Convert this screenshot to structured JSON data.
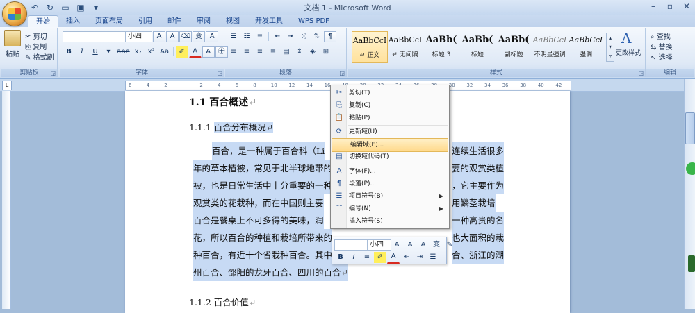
{
  "window": {
    "title": "文档 1 - Microsoft Word"
  },
  "tabs": [
    "开始",
    "插入",
    "页面布局",
    "引用",
    "邮件",
    "审阅",
    "视图",
    "开发工具",
    "WPS PDF"
  ],
  "clipboard": {
    "paste": "粘贴",
    "cut": "剪切",
    "copy": "复制",
    "format_painter": "格式刷",
    "label": "剪贴板"
  },
  "font": {
    "size_value": "小四",
    "label": "字体",
    "bold": "B",
    "italic": "I",
    "underline": "U",
    "strike": "abe",
    "sub": "x₂",
    "sup": "x²",
    "case": "Aa",
    "grow": "A",
    "shrink": "A",
    "phonetic": "变",
    "border_char": "A",
    "font_color": "A",
    "char_shading": "A",
    "enclose": "㊉"
  },
  "paragraph": {
    "label": "段落"
  },
  "styles": {
    "label": "样式",
    "items": [
      {
        "preview": "AaBbCcI",
        "name": "↵ 正文"
      },
      {
        "preview": "AaBbCcI",
        "name": "↵ 无间隔"
      },
      {
        "preview": "AaBb(",
        "name": "标题 3"
      },
      {
        "preview": "AaBb(",
        "name": "标题"
      },
      {
        "preview": "AaBb(",
        "name": "副标题"
      },
      {
        "preview": "AaBbCcI",
        "name": "不明显强调"
      },
      {
        "preview": "AaBbCcI",
        "name": "强调"
      }
    ],
    "change_styles": "更改样式"
  },
  "editing": {
    "label": "编辑",
    "find": "查找",
    "replace": "替换",
    "select": "选择"
  },
  "ruler": {
    "numbers": [
      "6",
      "4",
      "2",
      "",
      "2",
      "4",
      "6",
      "8",
      "10",
      "12",
      "14",
      "16",
      "18",
      "20",
      "22",
      "24",
      "26",
      "28",
      "30",
      "32",
      "34",
      "36",
      "38",
      "40",
      "42"
    ]
  },
  "document": {
    "h1": "1.1 百合概述",
    "h1_mark": "↵",
    "h2": "1.1.1 百合分布概况",
    "h2_mark": "↵",
    "lines": [
      "百合，是一种属于百合科（Li",
      "年的草本植被，常见于北半球地带的",
      "被，也是日常生活中十分重要的一种",
      "观赏类的花栽种，而在中国则主要",
      "百合是餐桌上不可多得的美味，润",
      "花，所以百合的种植和栽培所带来的",
      "种百合，有近十个省栽种百合。其中",
      "州百合、邵阳的龙牙百合、四川的百合"
    ],
    "right_fragments": [
      "连续生活很多",
      "要的观赏类植",
      "，它主要作为",
      "用鳞茎栽培",
      "一种高贵的名",
      "也大面积的栽",
      "合、浙江的湖",
      ""
    ],
    "last_end_mark": "↵",
    "h3": "1.1.2 百合价值",
    "h3_mark": "↵"
  },
  "context_menu": {
    "items": [
      {
        "label": "剪切(T)",
        "icon": "✂"
      },
      {
        "label": "复制(C)",
        "icon": "⎘"
      },
      {
        "label": "粘贴(P)",
        "icon": "📋"
      },
      {
        "label": "更新域(U)",
        "icon": "⟳"
      },
      {
        "label": "编辑域(E)...",
        "icon": ""
      },
      {
        "label": "切换域代码(T)",
        "icon": "▤"
      },
      {
        "label": "字体(F)...",
        "icon": "A"
      },
      {
        "label": "段落(P)...",
        "icon": "¶"
      },
      {
        "label": "项目符号(B)",
        "icon": "☰"
      },
      {
        "label": "编号(N)",
        "icon": "☷"
      },
      {
        "label": "插入符号(S)",
        "icon": ""
      }
    ],
    "highlighted_index": 4
  },
  "mini_toolbar": {
    "size_value": "小四"
  },
  "colors": {
    "ribbon_tab_text": "#15428b",
    "selection": "#c7daf4",
    "highlight": "#ffd98a"
  }
}
